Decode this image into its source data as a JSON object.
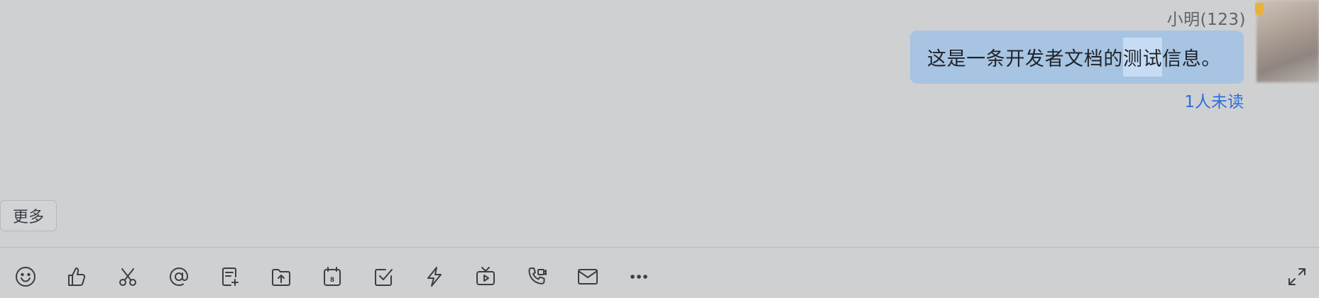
{
  "message": {
    "sender_name": "小明(123)",
    "text_before": "这是一条开发者文档的",
    "text_highlight": "测试",
    "text_after": "信息。",
    "read_status": "1人未读"
  },
  "more_label": "更多",
  "calendar_day": "8",
  "toolbar": {
    "icons": [
      "emoji-icon",
      "thumbs-up-icon",
      "scissors-icon",
      "at-icon",
      "new-doc-icon",
      "upload-file-icon",
      "calendar-icon",
      "task-check-icon",
      "lightning-icon",
      "live-tv-icon",
      "video-call-icon",
      "mail-icon",
      "more-dots-icon",
      "expand-icon"
    ]
  },
  "colors": {
    "background": "#cfd0d2",
    "bubble": "#a7c4e2",
    "highlight": "#c6dcf4",
    "link": "#2e6fd9"
  }
}
